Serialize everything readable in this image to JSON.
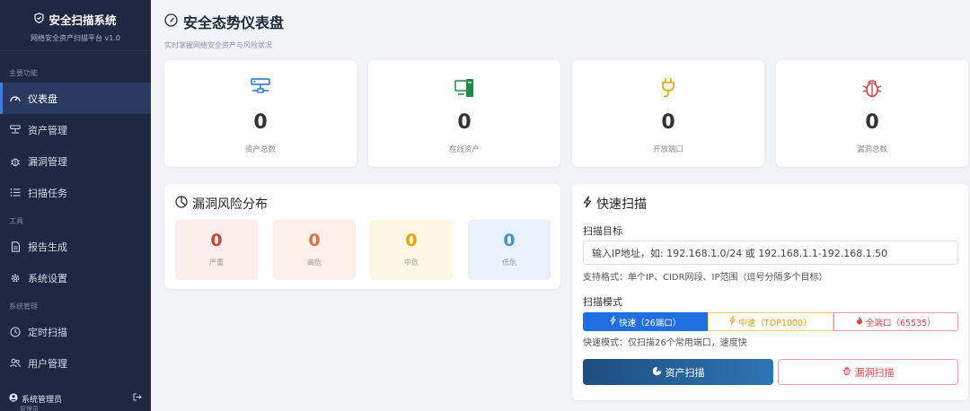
{
  "app": {
    "title": "安全扫描系统",
    "subtitle": "网络安全资产扫描平台 v1.0"
  },
  "sidebar": {
    "sections": [
      {
        "label": "主要功能",
        "items": [
          {
            "label": "仪表盘",
            "icon": "dashboard-icon",
            "active": true
          },
          {
            "label": "资产管理",
            "icon": "server-icon"
          },
          {
            "label": "漏洞管理",
            "icon": "bug-icon"
          },
          {
            "label": "扫描任务",
            "icon": "list-icon"
          }
        ]
      },
      {
        "label": "工具",
        "items": [
          {
            "label": "报告生成",
            "icon": "document-icon"
          },
          {
            "label": "系统设置",
            "icon": "gear-icon"
          }
        ]
      },
      {
        "label": "系统管理",
        "items": [
          {
            "label": "定时扫描",
            "icon": "clock-icon"
          },
          {
            "label": "用户管理",
            "icon": "users-icon"
          }
        ]
      }
    ],
    "user": {
      "name": "系统管理员",
      "role": "管理员"
    }
  },
  "header": {
    "title": "安全态势仪表盘",
    "subtitle": "实时掌握网络安全资产与风险状况"
  },
  "stats": [
    {
      "value": "0",
      "label": "资产总数",
      "color": "#1f6fd0",
      "icon": "network-server-icon"
    },
    {
      "value": "0",
      "label": "在线资产",
      "color": "#1e8a4c",
      "icon": "devices-icon"
    },
    {
      "value": "0",
      "label": "开放端口",
      "color": "#e3a400",
      "icon": "plug-icon"
    },
    {
      "value": "0",
      "label": "漏洞总数",
      "color": "#d33f3f",
      "icon": "bug-icon"
    }
  ],
  "risk": {
    "title": "漏洞风险分布",
    "levels": [
      {
        "value": "0",
        "label": "严重",
        "color": "#c8453c",
        "bg": "#fbeeec"
      },
      {
        "value": "0",
        "label": "高危",
        "color": "#e0723c",
        "bg": "#fdf0ea"
      },
      {
        "value": "0",
        "label": "中危",
        "color": "#e3a400",
        "bg": "#fdf6e2"
      },
      {
        "value": "0",
        "label": "低危",
        "color": "#4a90c9",
        "bg": "#e9f2fa"
      }
    ]
  },
  "quick_scan": {
    "title": "快速扫描",
    "target_label": "扫描目标",
    "target_value": "输入IP地址，如: 192.168.1.0/24 或 192.168.1.1-192.168.1.50",
    "target_hint": "支持格式：单个IP、CIDR网段、IP范围（逗号分隔多个目标）",
    "mode_label": "扫描模式",
    "modes": [
      {
        "label": "快速（26端口）",
        "selected": true
      },
      {
        "label": "中速（TOP1000）"
      },
      {
        "label": "全端口（65535）"
      }
    ],
    "mode_hint": "快速模式：仅扫描26个常用端口，速度快",
    "asset_button": "资产扫描",
    "vuln_button": "漏洞扫描"
  }
}
